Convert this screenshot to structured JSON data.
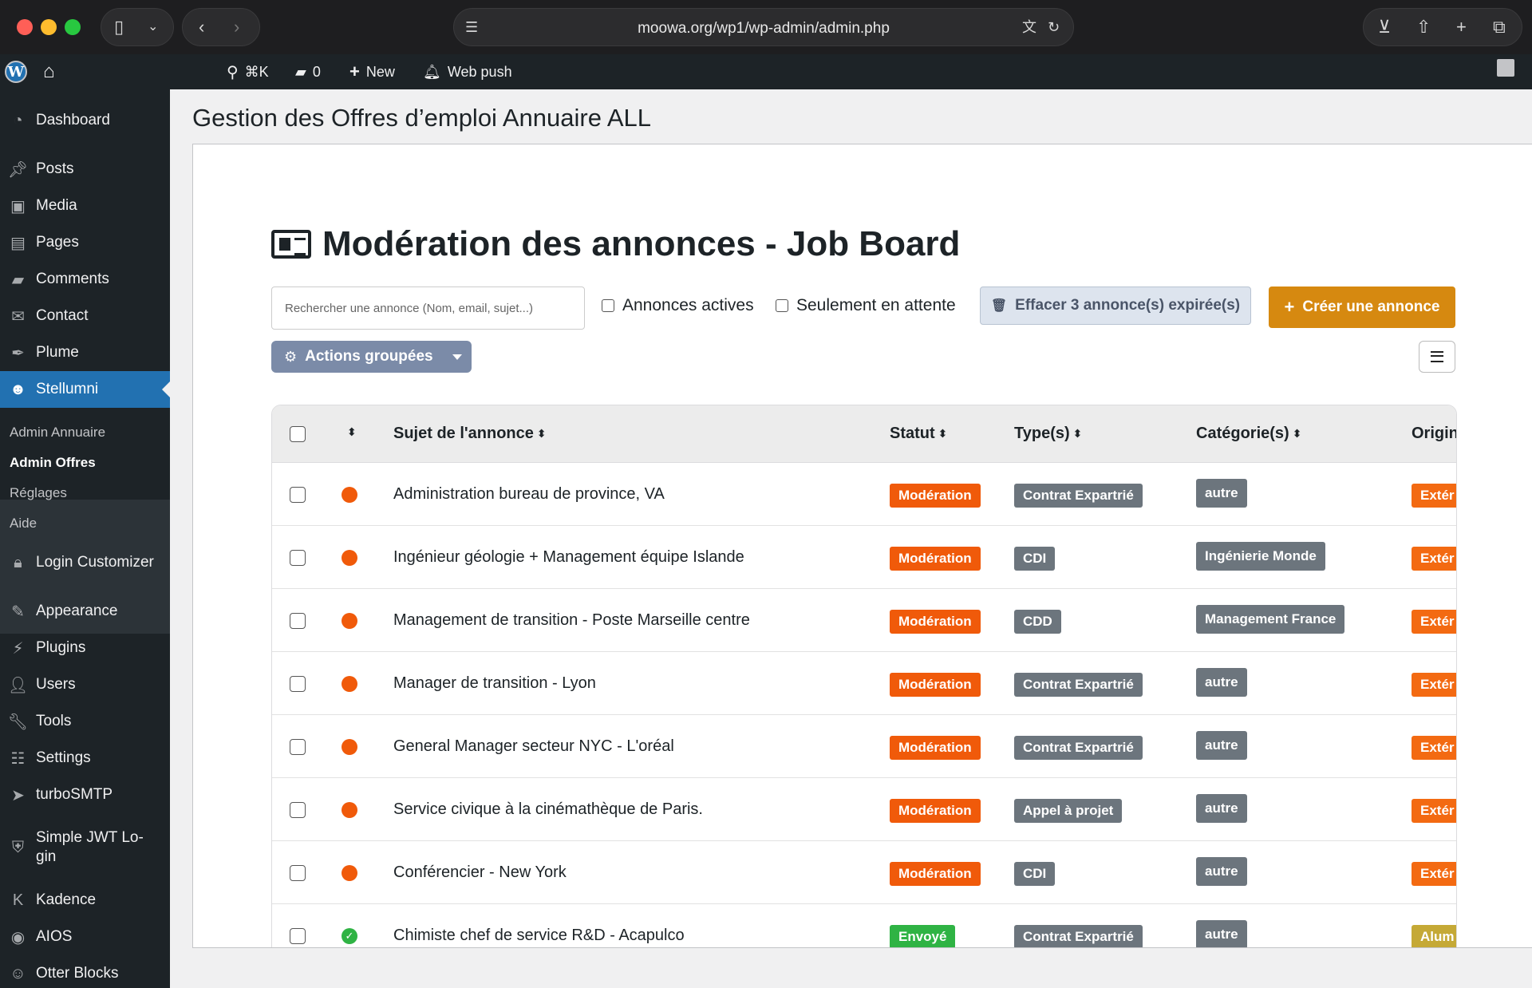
{
  "browser": {
    "url": "moowa.org/wp1/wp-admin/admin.php"
  },
  "adminbar": {
    "search_shortcut": "⌘K",
    "comments_count": "0",
    "new_label": "New",
    "webpush_label": "Web push"
  },
  "sidebar": {
    "items": [
      {
        "label": "Dashboard",
        "icon": "dashboard-icon"
      },
      {
        "label": "Posts",
        "icon": "pin-icon"
      },
      {
        "label": "Media",
        "icon": "media-icon"
      },
      {
        "label": "Pages",
        "icon": "pages-icon"
      },
      {
        "label": "Comments",
        "icon": "comment-icon"
      },
      {
        "label": "Contact",
        "icon": "envelope-icon"
      },
      {
        "label": "Plume",
        "icon": "feather-icon"
      },
      {
        "label": "Stellumni",
        "icon": "users-icon"
      },
      {
        "label": "Login Customizer",
        "icon": "lock-icon"
      },
      {
        "label": "Appearance",
        "icon": "brush-icon"
      },
      {
        "label": "Plugins",
        "icon": "plug-icon"
      },
      {
        "label": "Users",
        "icon": "user-icon"
      },
      {
        "label": "Tools",
        "icon": "wrench-icon"
      },
      {
        "label": "Settings",
        "icon": "settings-icon"
      },
      {
        "label": "turboSMTP",
        "icon": "turbo-icon"
      },
      {
        "label": "Simple JWT Lo-gin",
        "label_line1": "Simple JWT Lo-",
        "label_line2": "gin",
        "icon": "shield-icon"
      },
      {
        "label": "Kadence",
        "icon": "kadence-icon"
      },
      {
        "label": "AIOS",
        "icon": "aios-icon"
      },
      {
        "label": "Otter Blocks",
        "icon": "otter-icon"
      }
    ],
    "submenu": [
      "Admin Annuaire",
      "Admin Offres",
      "Réglages",
      "Aide"
    ]
  },
  "page": {
    "title": "Gestion des Offres d’emploi Annuaire ALL",
    "heading": "Modération des annonces - Job Board",
    "search_placeholder": "Rechercher une annonce (Nom, email, sujet...)",
    "filter_active": "Annonces actives",
    "filter_pending": "Seulement en attente",
    "clear_button": "Effacer 3 annonce(s) expirée(s)",
    "create_button": "Créer une annonce",
    "bulk_button": "Actions groupées"
  },
  "table": {
    "headers": {
      "subject": "Sujet de l'annonce",
      "status": "Statut",
      "types": "Type(s)",
      "categories": "Catégorie(s)",
      "origin": "Origin"
    },
    "rows": [
      {
        "subject": "Administration bureau de province, VA",
        "status": "Modération",
        "type": "Contrat Expartrié",
        "category": "autre",
        "origin": "Extér",
        "state": "pending"
      },
      {
        "subject": "Ingénieur géologie + Management équipe Islande",
        "status": "Modération",
        "type": "CDI",
        "category": "Ingénierie Monde",
        "origin": "Extér",
        "state": "pending"
      },
      {
        "subject": "Management de transition - Poste Marseille centre",
        "status": "Modération",
        "type": "CDD",
        "category": "Management France",
        "origin": "Extér",
        "state": "pending"
      },
      {
        "subject": "Manager de transition - Lyon",
        "status": "Modération",
        "type": "Contrat Expartrié",
        "category": "autre",
        "origin": "Extér",
        "state": "pending"
      },
      {
        "subject": "General Manager secteur NYC - L'oréal",
        "status": "Modération",
        "type": "Contrat Expartrié",
        "category": "autre",
        "origin": "Extér",
        "state": "pending"
      },
      {
        "subject": "Service civique à la cinémathèque de Paris.",
        "status": "Modération",
        "type": "Appel à projet",
        "category": "autre",
        "origin": "Extér",
        "state": "pending"
      },
      {
        "subject": "Conférencier - New York",
        "status": "Modération",
        "type": "CDI",
        "category": "autre",
        "origin": "Extér",
        "state": "pending"
      },
      {
        "subject": "Chimiste chef de service R&D - Acapulco",
        "status": "Envoyé",
        "type": "Contrat Expartrié",
        "category": "autre",
        "origin": "Alum",
        "state": "sent"
      }
    ]
  },
  "colors": {
    "moderation": "#f05a0a",
    "sent": "#2fb344",
    "type_badge": "#6c757d",
    "external": "#f36a12",
    "alumni": "#c5a936",
    "accent": "#2271b1",
    "create": "#d68910"
  }
}
